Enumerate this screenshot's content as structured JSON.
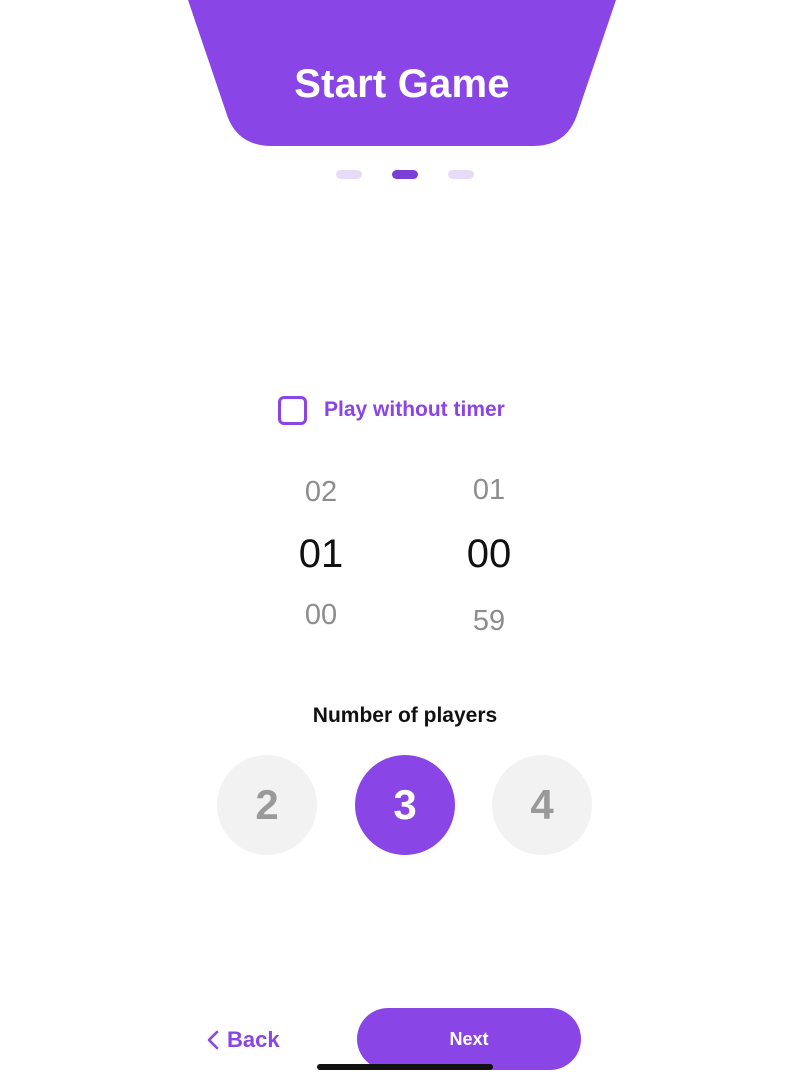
{
  "header": {
    "title": "Start Game"
  },
  "pager": {
    "pages": 3,
    "active": 2
  },
  "timer": {
    "checkbox_label": "Play without timer",
    "checked": false,
    "minutes": {
      "above": "02",
      "selected": "01",
      "below": "00"
    },
    "seconds": {
      "above": "01",
      "selected": "00",
      "below": "59"
    }
  },
  "players": {
    "title": "Number of players",
    "options": [
      "2",
      "3",
      "4"
    ],
    "selected": "3"
  },
  "nav": {
    "back_label": "Back",
    "next_label": "Next"
  },
  "colors": {
    "accent": "#8a45e6",
    "accent_dark": "#7b3fd8",
    "dot_inactive": "#e6dcf7",
    "chip_inactive": "#f2f2f2"
  }
}
